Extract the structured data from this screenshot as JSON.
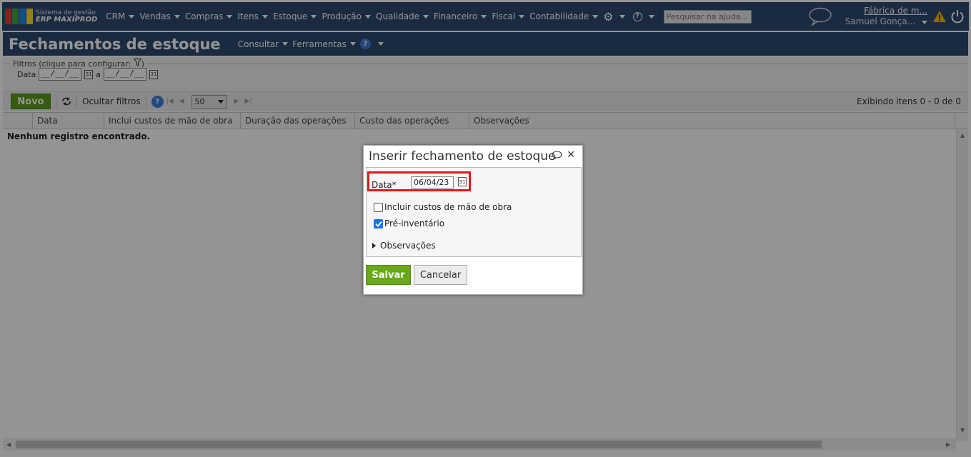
{
  "app": {
    "logo_line1": "Sistema de gestão",
    "logo_line2": "ERP MAXIPROD",
    "logo_colors": [
      "#e53935",
      "#43a047",
      "#1e88e5",
      "#fdd835"
    ]
  },
  "nav": {
    "menus": [
      "CRM",
      "Vendas",
      "Compras",
      "Itens",
      "Estoque",
      "Produção",
      "Qualidade",
      "Financeiro",
      "Fiscal",
      "Contabilidade"
    ],
    "search_placeholder": "Pesquisar na ajuda...",
    "company": "Fábrica de m...",
    "user": "Samuel Gonça..."
  },
  "page": {
    "title": "Fechamentos de estoque",
    "menu_consultar": "Consultar",
    "menu_ferramentas": "Ferramentas"
  },
  "filters": {
    "legend": "Filtros (clique para configurar:",
    "legend_end": ")",
    "date_label": "Data",
    "date_from": "__/__/__",
    "date_sep": "a",
    "date_to": "__/__/__"
  },
  "toolbar": {
    "new_label": "Novo",
    "hide_filters": "Ocultar filtros",
    "page_size": "50",
    "display_count": "Exibindo itens 0 - 0 de 0"
  },
  "grid": {
    "columns": [
      "Data",
      "Inclui custos de mão de obra",
      "Duração das operações",
      "Custo das operações",
      "Observações"
    ],
    "empty_message": "Nenhum registro encontrado."
  },
  "dialog": {
    "title": "Inserir fechamento de estoque",
    "date_label": "Data*",
    "date_value": "06/04/23",
    "labor_costs_label": "Incluir custos de mão de obra",
    "labor_costs_checked": false,
    "pre_inventory_label": "Pré-inventário",
    "pre_inventory_checked": true,
    "observations_label": "Observações",
    "save_label": "Salvar",
    "cancel_label": "Cancelar"
  },
  "colors": {
    "nav_bg": "#2e4b70",
    "save_green": "#69a81a",
    "highlight_red": "#d81b1b",
    "check_blue": "#1a73e8"
  }
}
